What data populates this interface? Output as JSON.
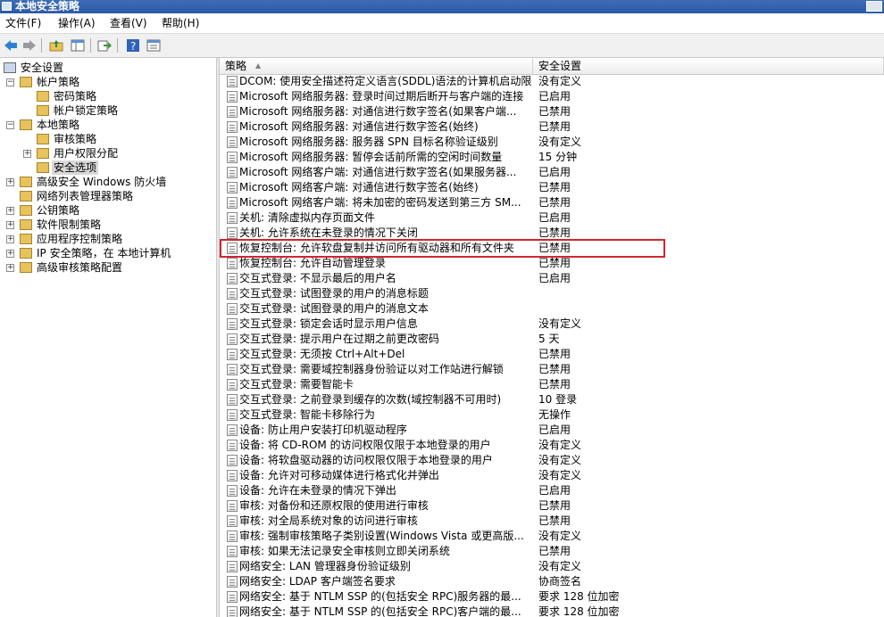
{
  "window": {
    "title": "本地安全策略"
  },
  "menu": [
    "文件(F)",
    "操作(A)",
    "查看(V)",
    "帮助(H)"
  ],
  "toolbar": {
    "buttons": [
      "back-icon",
      "forward-icon",
      "up-folder-icon",
      "show-hide-tree-icon",
      "export-list-icon",
      "help-icon",
      "properties-icon"
    ]
  },
  "tree": {
    "root": "安全设置",
    "nodes": [
      {
        "label": "帐户策略",
        "level": 1,
        "expander": "-"
      },
      {
        "label": "密码策略",
        "level": 2,
        "expander": ""
      },
      {
        "label": "帐户锁定策略",
        "level": 2,
        "expander": ""
      },
      {
        "label": "本地策略",
        "level": 1,
        "expander": "-"
      },
      {
        "label": "审核策略",
        "level": 2,
        "expander": ""
      },
      {
        "label": "用户权限分配",
        "level": 2,
        "expander": "+"
      },
      {
        "label": "安全选项",
        "level": 2,
        "expander": "",
        "selected": true
      },
      {
        "label": "高级安全 Windows 防火墙",
        "level": 1,
        "expander": "+"
      },
      {
        "label": "网络列表管理器策略",
        "level": 1,
        "expander": ""
      },
      {
        "label": "公钥策略",
        "level": 1,
        "expander": "+"
      },
      {
        "label": "软件限制策略",
        "level": 1,
        "expander": "+"
      },
      {
        "label": "应用程序控制策略",
        "level": 1,
        "expander": "+"
      },
      {
        "label": "IP 安全策略，在 本地计算机",
        "level": 1,
        "expander": "+"
      },
      {
        "label": "高级审核策略配置",
        "level": 1,
        "expander": "+"
      }
    ]
  },
  "table": {
    "headers": {
      "policy": "策略",
      "setting": "安全设置"
    },
    "highlighted_row": 11,
    "rows": [
      {
        "policy": "DCOM: 使用安全描述符定义语言(SDDL)语法的计算机启动限制",
        "setting": "没有定义"
      },
      {
        "policy": "Microsoft 网络服务器: 登录时间过期后断开与客户端的连接",
        "setting": "已启用"
      },
      {
        "policy": "Microsoft 网络服务器: 对通信进行数字签名(如果客户端...",
        "setting": "已禁用"
      },
      {
        "policy": "Microsoft 网络服务器: 对通信进行数字签名(始终)",
        "setting": "已禁用"
      },
      {
        "policy": "Microsoft 网络服务器: 服务器 SPN 目标名称验证级别",
        "setting": "没有定义"
      },
      {
        "policy": "Microsoft 网络服务器: 暂停会话前所需的空闲时间数量",
        "setting": "15 分钟"
      },
      {
        "policy": "Microsoft 网络客户端: 对通信进行数字签名(如果服务器...",
        "setting": "已启用"
      },
      {
        "policy": "Microsoft 网络客户端: 对通信进行数字签名(始终)",
        "setting": "已禁用"
      },
      {
        "policy": "Microsoft 网络客户端: 将未加密的密码发送到第三方 SM...",
        "setting": "已禁用"
      },
      {
        "policy": "关机: 清除虚拟内存页面文件",
        "setting": "已启用"
      },
      {
        "policy": "关机: 允许系统在未登录的情况下关闭",
        "setting": "已禁用"
      },
      {
        "policy": "恢复控制台: 允许软盘复制并访问所有驱动器和所有文件夹",
        "setting": "已禁用"
      },
      {
        "policy": "恢复控制台: 允许自动管理登录",
        "setting": "已禁用"
      },
      {
        "policy": "交互式登录: 不显示最后的用户名",
        "setting": "已启用"
      },
      {
        "policy": "交互式登录: 试图登录的用户的消息标题",
        "setting": ""
      },
      {
        "policy": "交互式登录: 试图登录的用户的消息文本",
        "setting": ""
      },
      {
        "policy": "交互式登录: 锁定会话时显示用户信息",
        "setting": "没有定义"
      },
      {
        "policy": "交互式登录: 提示用户在过期之前更改密码",
        "setting": "5 天"
      },
      {
        "policy": "交互式登录: 无须按 Ctrl+Alt+Del",
        "setting": "已禁用"
      },
      {
        "policy": "交互式登录: 需要域控制器身份验证以对工作站进行解锁",
        "setting": "已禁用"
      },
      {
        "policy": "交互式登录: 需要智能卡",
        "setting": "已禁用"
      },
      {
        "policy": "交互式登录: 之前登录到缓存的次数(域控制器不可用时)",
        "setting": "10 登录"
      },
      {
        "policy": "交互式登录: 智能卡移除行为",
        "setting": "无操作"
      },
      {
        "policy": "设备: 防止用户安装打印机驱动程序",
        "setting": "已启用"
      },
      {
        "policy": "设备: 将 CD-ROM 的访问权限仅限于本地登录的用户",
        "setting": "没有定义"
      },
      {
        "policy": "设备: 将软盘驱动器的访问权限仅限于本地登录的用户",
        "setting": "没有定义"
      },
      {
        "policy": "设备: 允许对可移动媒体进行格式化并弹出",
        "setting": "没有定义"
      },
      {
        "policy": "设备: 允许在未登录的情况下弹出",
        "setting": "已启用"
      },
      {
        "policy": "审核: 对备份和还原权限的使用进行审核",
        "setting": "已禁用"
      },
      {
        "policy": "审核: 对全局系统对象的访问进行审核",
        "setting": "已禁用"
      },
      {
        "policy": "审核: 强制审核策略子类别设置(Windows Vista 或更高版...",
        "setting": "没有定义"
      },
      {
        "policy": "审核: 如果无法记录安全审核则立即关闭系统",
        "setting": "已禁用"
      },
      {
        "policy": "网络安全: LAN 管理器身份验证级别",
        "setting": "没有定义"
      },
      {
        "policy": "网络安全: LDAP 客户端签名要求",
        "setting": "协商签名"
      },
      {
        "policy": "网络安全: 基于 NTLM SSP 的(包括安全 RPC)服务器的最...",
        "setting": "要求 128 位加密"
      },
      {
        "policy": "网络安全: 基于 NTLM SSP 的(包括安全 RPC)客户端的最...",
        "setting": "要求 128 位加密"
      }
    ]
  },
  "colors": {
    "titlebar": "#2a5aa6",
    "highlight_border": "#d0262e",
    "folder": "#e8c25a",
    "selected_bg": "#d8d8d8"
  }
}
